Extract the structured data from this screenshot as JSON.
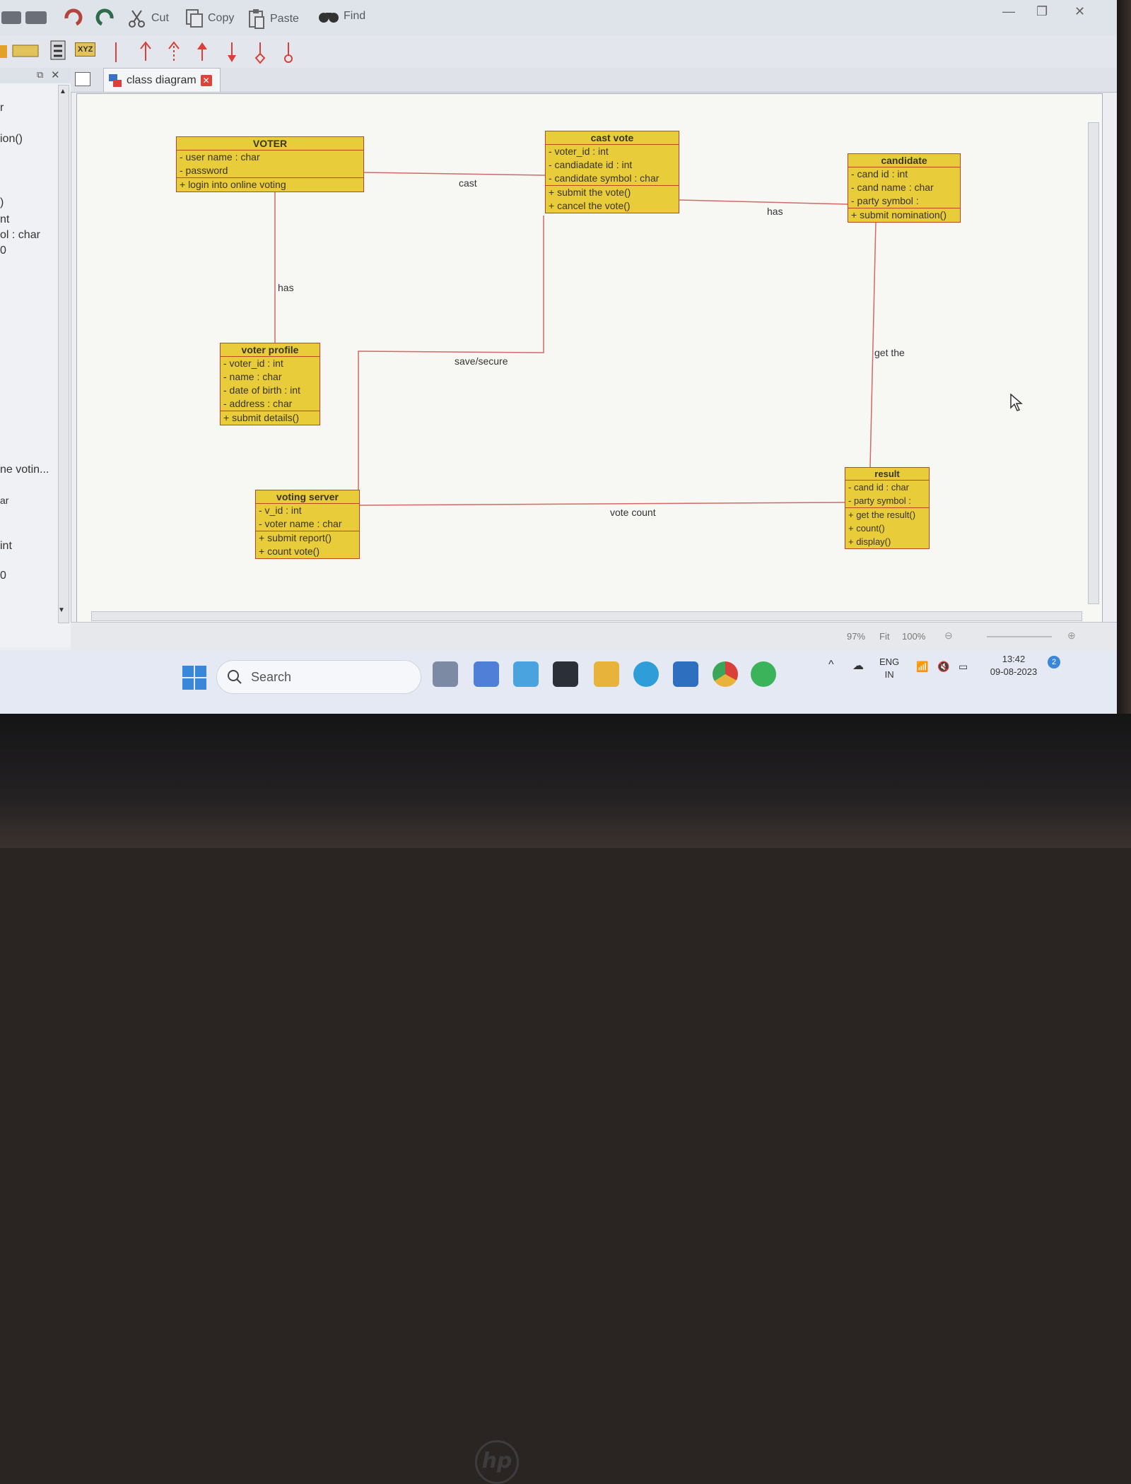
{
  "toolbar": {
    "cut_label": "Cut",
    "copy_label": "Copy",
    "paste_label": "Paste",
    "find_label": "Find",
    "xyz_label": "XYZ"
  },
  "left_panel": {
    "items": [
      "r",
      "ion()",
      ")",
      "nt",
      "ol : char",
      "0",
      "ne votin...",
      "ar",
      "int",
      "0"
    ]
  },
  "tab": {
    "label": "class diagram"
  },
  "diagram": {
    "voter": {
      "name": "VOTER",
      "attributes": [
        "- user name : char",
        "- password"
      ],
      "operations": [
        "+ login into online voting"
      ]
    },
    "cast_vote": {
      "name": "cast vote",
      "attributes": [
        "- voter_id : int",
        "- candiadate id : int",
        "- candidate symbol : char"
      ],
      "operations": [
        "+ submit the vote()",
        "+ cancel the vote()"
      ]
    },
    "candidate": {
      "name": "candidate",
      "attributes": [
        "- cand id : int",
        "- cand name : char",
        "- party symbol :"
      ],
      "operations": [
        "+ submit nomination()"
      ]
    },
    "voter_profile": {
      "name": "voter profile",
      "attributes": [
        "- voter_id : int",
        "- name : char",
        "- date of birth : int",
        "- address : char"
      ],
      "operations": [
        "+ submit details()"
      ]
    },
    "voting_server": {
      "name": "voting server",
      "attributes": [
        "- v_id : int",
        "- voter name : char"
      ],
      "operations": [
        "+ submit report()",
        "+ count vote()"
      ]
    },
    "result": {
      "name": "result",
      "attributes": [
        "- cand id : char",
        "- party symbol :"
      ],
      "operations": [
        "+ get the result()",
        "+ count()",
        "+ display()"
      ]
    },
    "associations": {
      "cast": "cast",
      "has_profile": "has",
      "has_candidate": "has",
      "save_secure": "save/secure",
      "get_the": "get the",
      "vote_count": "vote count"
    }
  },
  "statusbar": {
    "zoom": "97%",
    "fit": "Fit",
    "full": "100%"
  },
  "taskbar": {
    "search_placeholder": "Search",
    "lang": "ENG",
    "region": "IN",
    "time": "13:42",
    "date": "09-08-2023",
    "notification_count": "2"
  }
}
